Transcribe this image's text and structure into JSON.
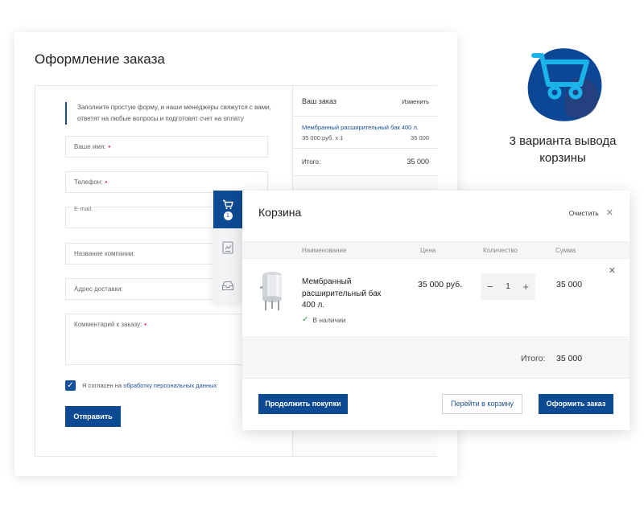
{
  "order_form": {
    "title": "Оформление заказа",
    "note": "Заполните простую форму, и наши менеджеры свяжутся с вами, ответят на любые вопросы и подготовят счет на оплату",
    "fields": {
      "name": "Ваше имя:",
      "phone": "Телефон:",
      "email": "E-mail:",
      "company": "Название компании:",
      "address": "Адрес доставки:",
      "comment": "Комментарий к заказу:"
    },
    "required_mark": "•",
    "agree_text": "Я согласен на",
    "agree_link": "обработку персональных данных",
    "submit": "Отправить"
  },
  "order_summary": {
    "title": "Ваш заказ",
    "change": "Изменить",
    "item_name": "Мембранный расширительный бак 400 л.",
    "item_qty": "35 000 руб. x 1",
    "item_price": "35 000",
    "total_label": "Итого:",
    "total_value": "35 000"
  },
  "sidebar": {
    "cart_count": "1",
    "icons": [
      "cart-icon",
      "compare-icon",
      "inbox-icon"
    ]
  },
  "cart": {
    "title": "Корзина",
    "clear": "Очистить",
    "columns": {
      "name": "Наименование",
      "price": "Цена",
      "qty": "Количество",
      "sum": "Сумма"
    },
    "item": {
      "name": "Мембранный расширительный бак 400 л.",
      "stock": "В наличии",
      "price": "35 000 руб.",
      "qty": "1",
      "sum": "35 000"
    },
    "total_label": "Итого:",
    "total_value": "35 000",
    "btn_continue": "Продолжить покупки",
    "btn_gocart": "Перейти в корзину",
    "btn_checkout": "Оформить заказ"
  },
  "promo": {
    "caption": "3 варианта вывода корзины"
  },
  "colors": {
    "accent": "#0d4a94",
    "link": "#1c4e9a",
    "required": "#d3172c",
    "in_stock": "#31a14a",
    "promo_cyan": "#1bb4ea"
  }
}
